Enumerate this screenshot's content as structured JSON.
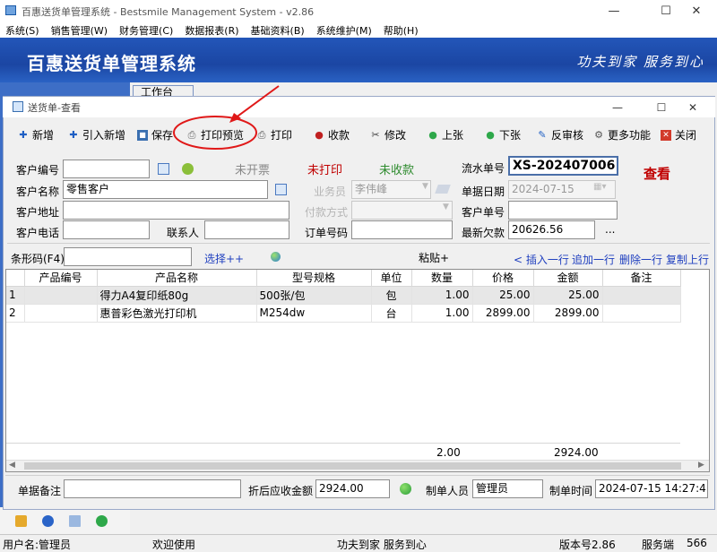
{
  "app": {
    "title": "百惠送货单管理系统 - Bestsmile Management System - v2.86",
    "menu": [
      "系统(S)",
      "销售管理(W)",
      "财务管理(C)",
      "数据报表(R)",
      "基础资料(B)",
      "系统维护(M)",
      "帮助(H)"
    ],
    "banner_title": "百惠送货单管理系统",
    "banner_slogan": "功夫到家 服务到心",
    "workbench_tab": "工作台"
  },
  "window": {
    "title": "送货单-查看"
  },
  "toolbar": {
    "new": "新增",
    "import_new": "引入新增",
    "save": "保存",
    "print_preview": "打印预览",
    "print": "打印",
    "receive": "收款",
    "modify": "修改",
    "prev": "上张",
    "next": "下张",
    "unaudit": "反审核",
    "more": "更多功能",
    "close": "关闭"
  },
  "form": {
    "customer_no_label": "客户编号",
    "customer_no": "",
    "status_invoice": "未开票",
    "status_print": "未打印",
    "status_receive": "未收款",
    "serial_label": "流水单号",
    "serial": "XS-202407006",
    "view_badge": "查看",
    "customer_name_label": "客户名称",
    "customer_name": "零售客户",
    "salesman_label": "业务员",
    "salesman": "李伟峰",
    "date_label": "单据日期",
    "date": "2024-07-15",
    "address_label": "客户地址",
    "address": "",
    "payment_label": "付款方式",
    "payment": "",
    "cust_order_label": "客户单号",
    "cust_order": "",
    "phone_label": "客户电话",
    "phone": "",
    "contact_label": "联系人",
    "contact": "",
    "order_no_label": "订单号码",
    "order_no": "",
    "balance_label": "最新欠款",
    "balance": "20626.56",
    "more_dots": "...",
    "barcode_label": "条形码(F4)",
    "barcode": "",
    "select_link": "选择++",
    "paste_link": "粘贴+",
    "insert_row": "< 插入一行",
    "append_row": "追加一行",
    "delete_row": "删除一行",
    "copy_row": "复制上行"
  },
  "grid": {
    "columns": [
      "",
      "产品编号",
      "产品名称",
      "型号规格",
      "单位",
      "数量",
      "价格",
      "金额",
      "备注"
    ],
    "rows": [
      [
        "1",
        "",
        "得力A4复印纸80g",
        "500张/包",
        "包",
        "1.00",
        "25.00",
        "25.00",
        ""
      ],
      [
        "2",
        "",
        "惠普彩色激光打印机",
        "M254dw",
        "台",
        "1.00",
        "2899.00",
        "2899.00",
        ""
      ]
    ],
    "total_qty": "2.00",
    "total_amount": "2924.00"
  },
  "bottom": {
    "remark_label": "单据备注",
    "remark": "",
    "receivable_label": "折后应收金额",
    "receivable": "2924.00",
    "creator_label": "制单人员",
    "creator": "管理员",
    "time_label": "制单时间",
    "time": "2024-07-15 14:27:41"
  },
  "status": {
    "user": "用户名:管理员",
    "welcome": "欢迎使用",
    "slogan": "功夫到家 服务到心",
    "version": "版本号2.86",
    "server": "服务端",
    "port": "566"
  },
  "colors": {
    "banner_blue": "#1b46a3",
    "status_red": "#c00000",
    "status_green": "#2e8b2e",
    "link_blue": "#1f3fbf",
    "annotation_red": "#e01818"
  }
}
